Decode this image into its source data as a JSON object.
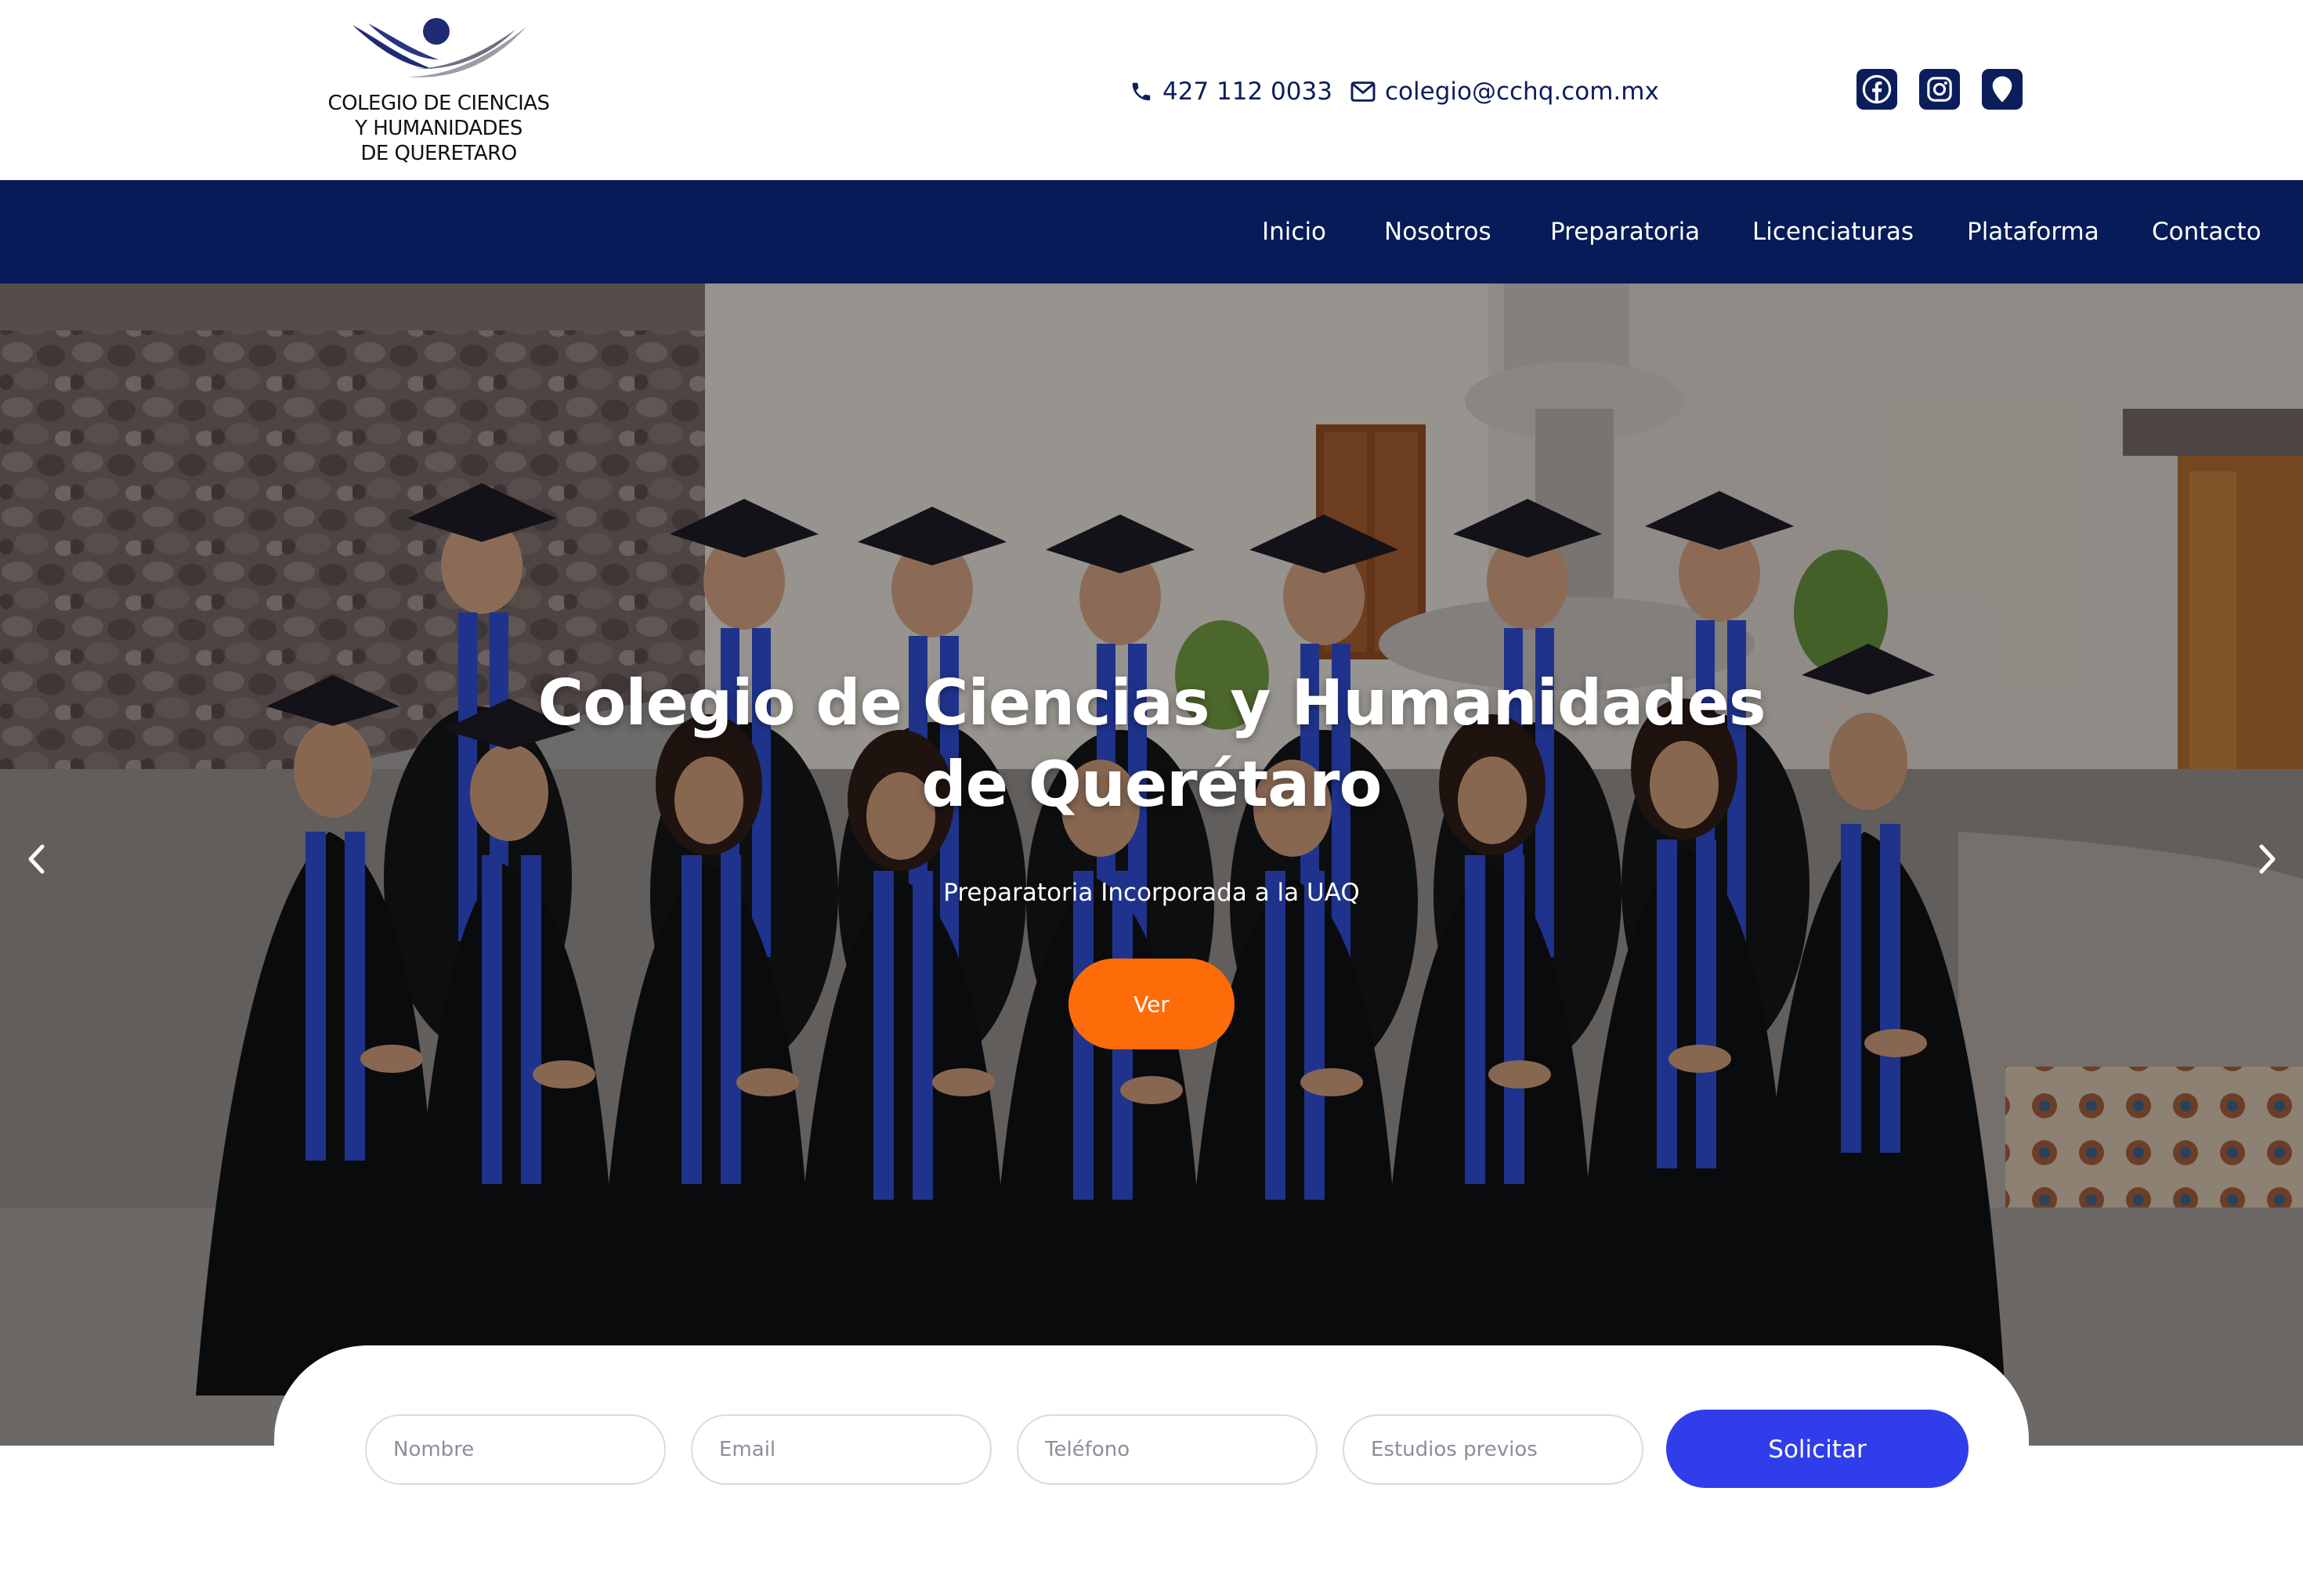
{
  "header": {
    "logo": {
      "lines": [
        "COLEGIO DE CIENCIAS",
        "Y HUMANIDADES",
        "DE QUERETARO"
      ]
    },
    "phone": "427 112 0033",
    "email": "colegio@cchq.com.mx",
    "social_icons": [
      "facebook-icon",
      "instagram-icon",
      "map-pin-icon"
    ],
    "colors": {
      "navy": "#061b57",
      "icon_bg": "#0b1e5b",
      "text": "#0c1e5b"
    }
  },
  "nav": {
    "items": [
      "Inicio",
      "Nosotros",
      "Preparatoria",
      "Licenciaturas",
      "Plataforma",
      "Contacto"
    ]
  },
  "hero": {
    "title_lines": [
      "Colegio de Ciencias y Humanidades",
      "de Querétaro"
    ],
    "subtitle": "Preparatoria Incorporada a la UAQ",
    "cta_label": "Ver",
    "cta_color": "#fd6c08",
    "prev_icon": "chevron-left-icon",
    "next_icon": "chevron-right-icon"
  },
  "form": {
    "fields": [
      {
        "placeholder": "Nombre",
        "value": ""
      },
      {
        "placeholder": "Email",
        "value": ""
      },
      {
        "placeholder": "Teléfono",
        "value": ""
      },
      {
        "placeholder": "Estudios previos",
        "value": ""
      }
    ],
    "submit_label": "Solicitar",
    "submit_color": "#2f3eea"
  }
}
